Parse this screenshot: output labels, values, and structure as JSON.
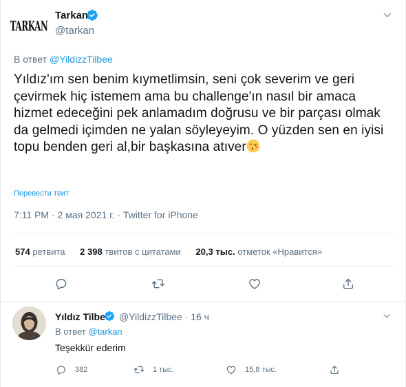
{
  "tweet": {
    "author_name": "Tarkan",
    "author_handle": "@tarkan",
    "logo_text": "TARKAN",
    "reply_prefix": "В ответ",
    "reply_mention": "@YildizzTilbee",
    "text": "Yıldız'ım sen benim kıymetlimsin, seni çok severim ve geri çevirmek hiç istemem ama bu challenge'ın nasıl bir amaca hizmet edeceğini pek anlamadım doğrusu ve bir parçası olmak da gelmedi içimden ne yalan söyleyeyim. O yüzden sen en iyisi topu benden geri al,bir başkasına atıver",
    "emoji": "face-blowing-kiss",
    "translate_label": "Перевести твит",
    "time": "7:11 PM",
    "date": "2 мая 2021 г.",
    "source": "Twitter for iPhone",
    "separator": "·"
  },
  "stats": {
    "retweets_count": "574",
    "retweets_label": "ретвита",
    "quotes_count": "2 398",
    "quotes_label": "твитов с цитатами",
    "likes_count": "20,3 тыс.",
    "likes_label": "отметок «Нравится»"
  },
  "actions": [
    "reply-icon",
    "retweet-icon",
    "like-icon",
    "share-icon"
  ],
  "reply": {
    "name": "Yıldız Tilbe",
    "handle": "@YildizzTilbee",
    "age": "16 ч",
    "separator": "·",
    "reply_prefix": "В ответ",
    "reply_mention": "@tarkan",
    "text": "Teşekkür ederim",
    "reply_count": "382",
    "retweet_count": "1 тыс.",
    "like_count": "15,8 тыс."
  },
  "colors": {
    "accent": "#1b95e0",
    "secondary_text": "#5b7083",
    "divider": "#e6ecf0",
    "verified": "#1da1f2"
  }
}
